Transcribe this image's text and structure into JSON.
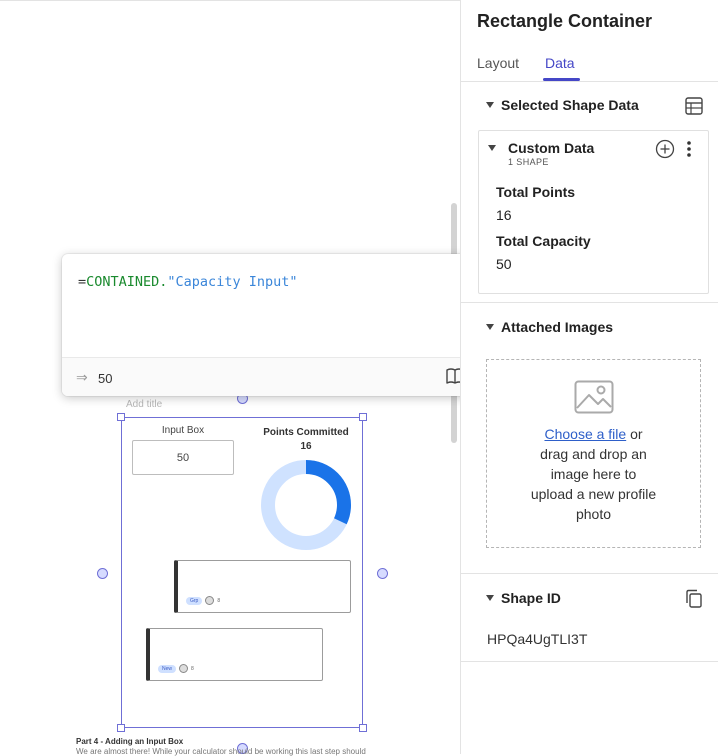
{
  "canvas": {
    "add_title_placeholder": "Add title",
    "input_box": {
      "label": "Input Box",
      "value": "50"
    },
    "points_widget": {
      "label": "Points Committed",
      "value": "16",
      "fill_fraction": 0.32
    },
    "card_1": {
      "tag": "Grp",
      "count": "8"
    },
    "card_2": {
      "tag": "New",
      "count": "8"
    },
    "doc": {
      "heading": "Part 4 - Adding an Input Box",
      "body": "We are almost there! While your calculator should be working this last step should"
    }
  },
  "formula": {
    "eq": "=",
    "fn": "CONTAINED.",
    "str": "\"Capacity Input\"",
    "result_arrow": "⇒",
    "result": "50"
  },
  "panel": {
    "title": "Rectangle Container",
    "tabs": {
      "layout": "Layout",
      "data": "Data"
    },
    "selected_shape_data": {
      "title": "Selected Shape Data",
      "custom_data": {
        "title": "Custom Data",
        "subtitle": "1 SHAPE",
        "fields": [
          {
            "label": "Total Points",
            "value": "16"
          },
          {
            "label": "Total Capacity",
            "value": "50"
          }
        ]
      }
    },
    "attached_images": {
      "title": "Attached Images",
      "link": "Choose a file",
      "text_after_link": " or",
      "text_rest": "drag and drop an image here to upload a new profile photo"
    },
    "shape_id": {
      "title": "Shape ID",
      "value": "HPQa4UgTLI3T"
    }
  },
  "colors": {
    "accent": "#4547c7",
    "selection": "#6f6fd6",
    "donut_fill": "#1a73e8",
    "donut_track": "#cfe2ff",
    "link": "#2e5fc9"
  },
  "icons": [
    "table-icon",
    "plus-circle-icon",
    "kebab-icon",
    "image-icon",
    "copy-icon",
    "book-icon",
    "result-arrow-icon",
    "caret-down-icon"
  ]
}
